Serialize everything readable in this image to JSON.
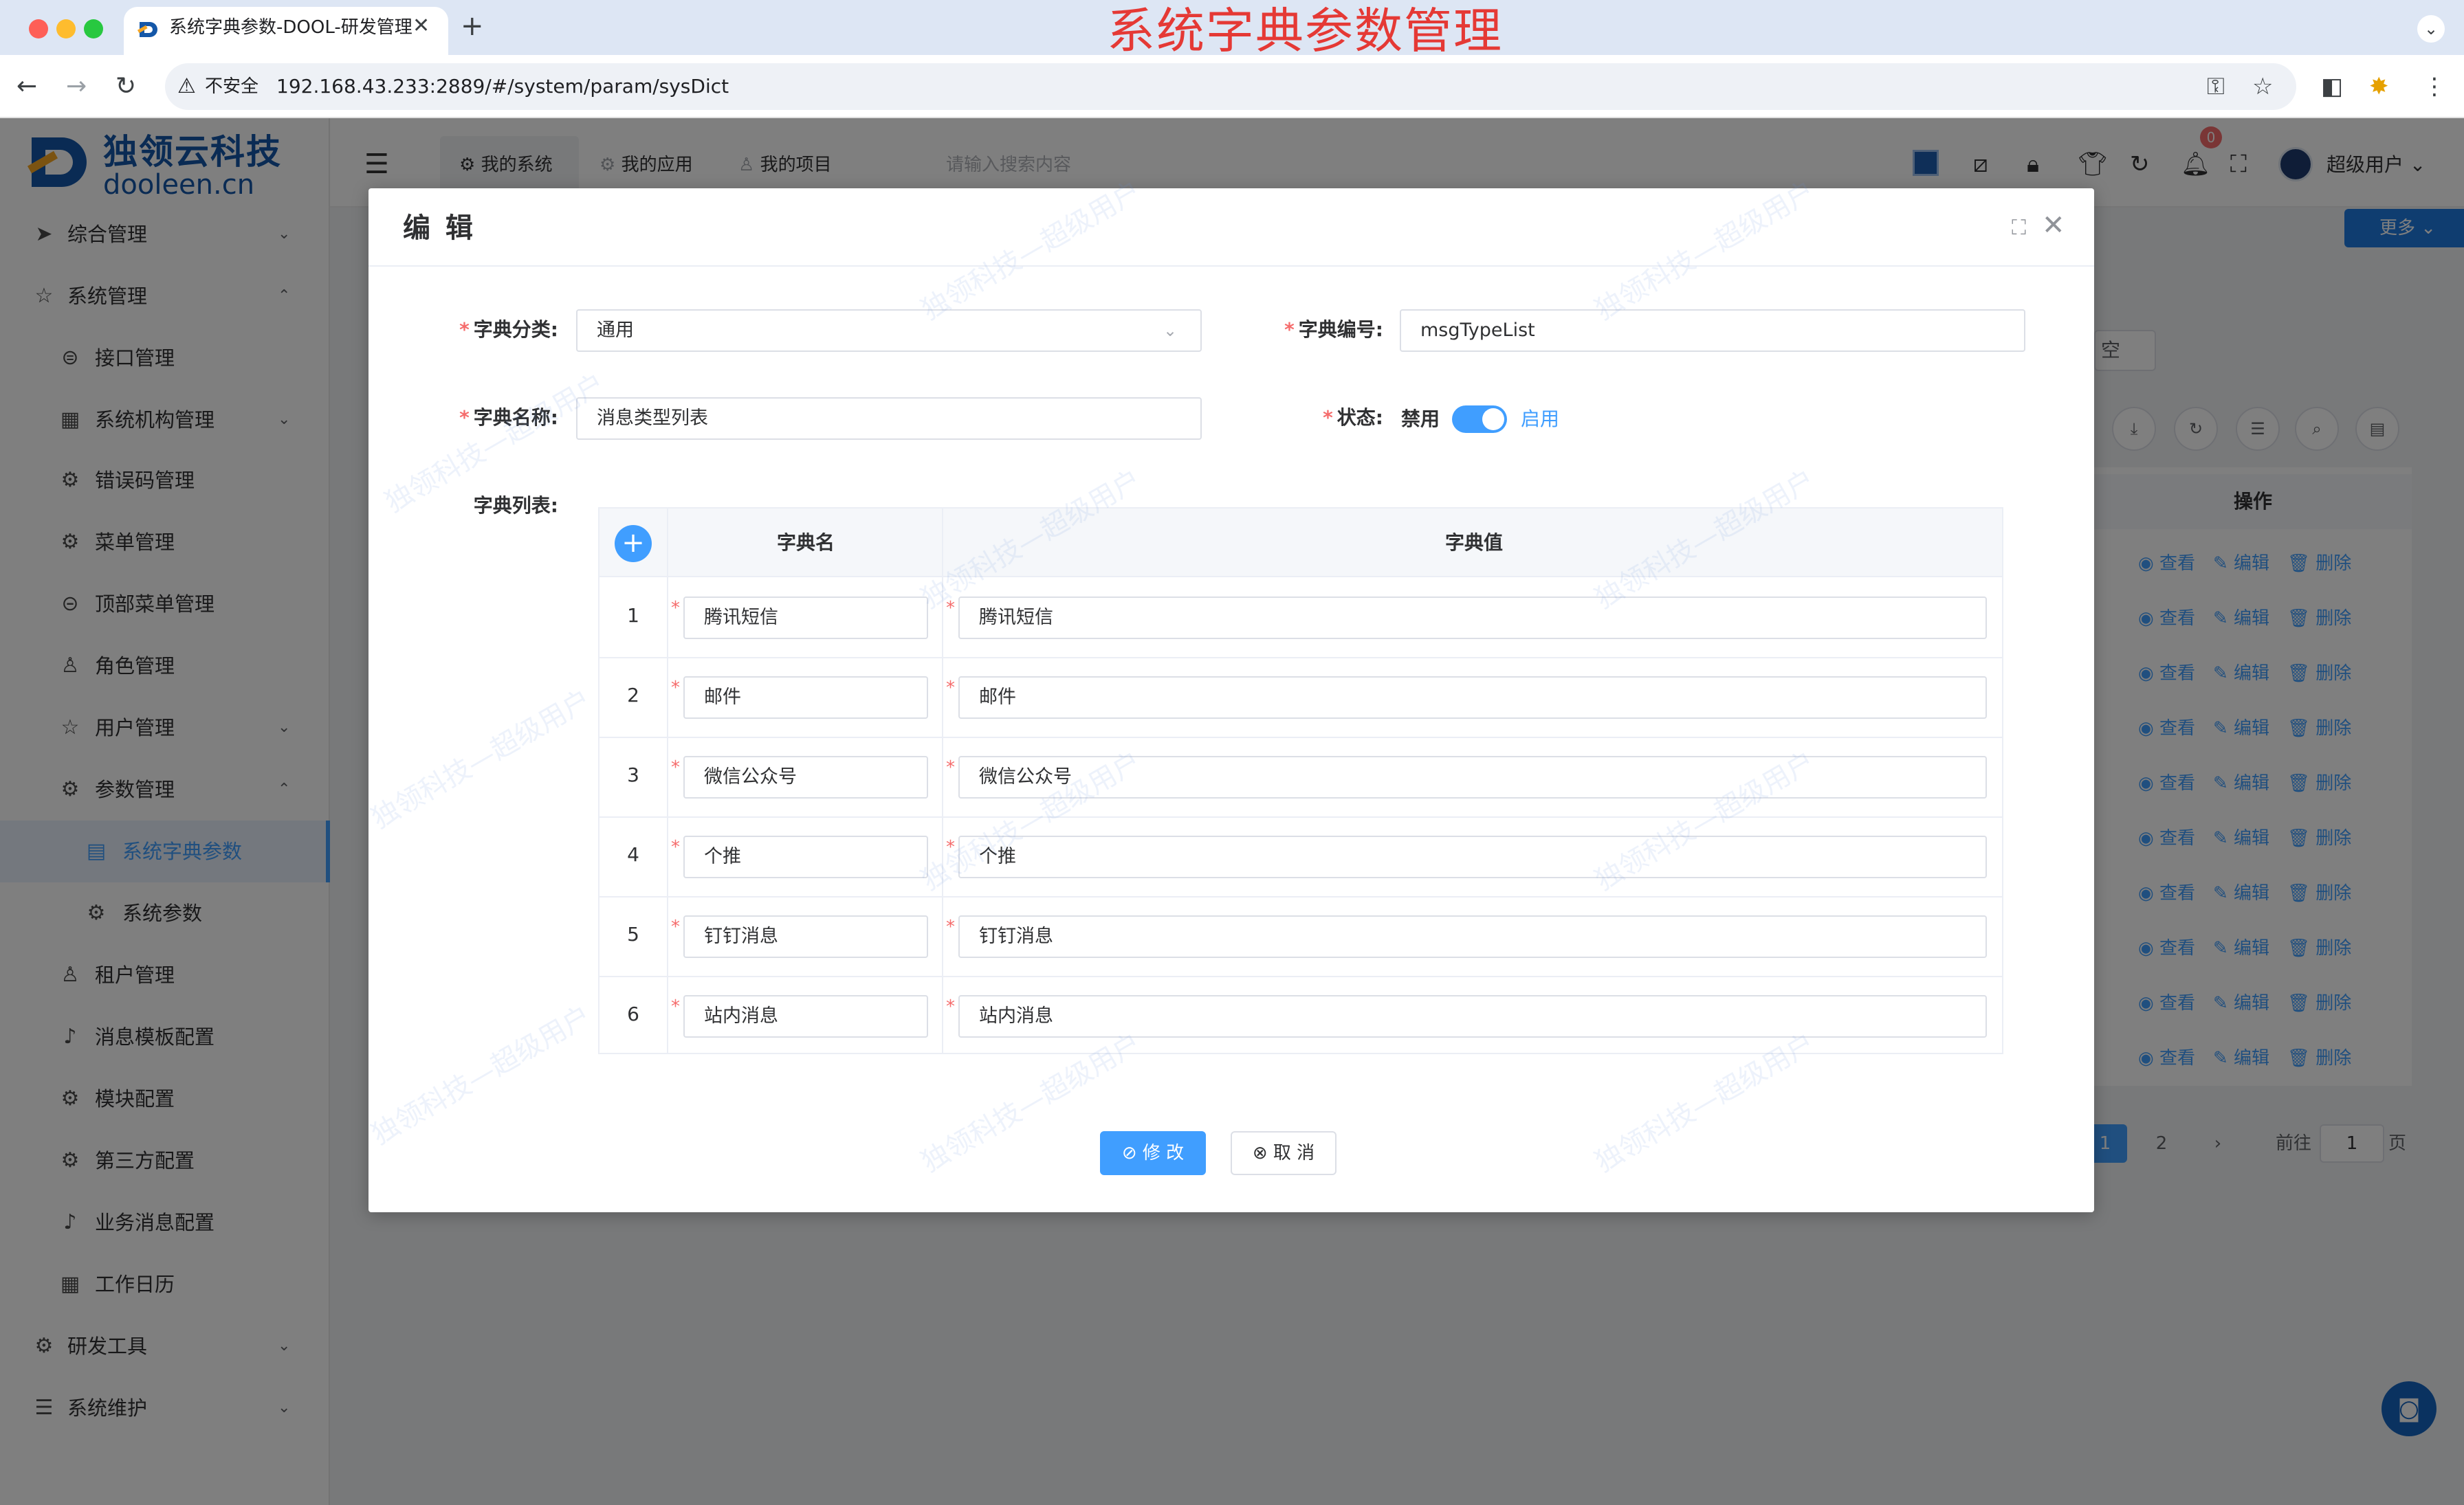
{
  "browser": {
    "tab_title": "系统字典参数-DOOL-研发管理",
    "tab_close": "✕",
    "new_tab": "+",
    "overlay_caption": "系统字典参数管理",
    "security_label": "不安全",
    "url": "192.168.43.233:2889/#/system/param/sysDict",
    "tabs_menu": "⌄"
  },
  "brand": {
    "name_cn": "独领云科技",
    "name_en": "dooleen.cn"
  },
  "sidebar": {
    "items": [
      {
        "label": "综合管理",
        "icon": "send-icon",
        "glyph": "➤",
        "chevron": "⌄"
      },
      {
        "label": "系统管理",
        "icon": "star-icon",
        "glyph": "☆",
        "chevron": "⌃"
      },
      {
        "label": "接口管理",
        "icon": "api-icon",
        "glyph": "⊜"
      },
      {
        "label": "系统机构管理",
        "icon": "grid-icon",
        "glyph": "▦",
        "chevron": "⌄"
      },
      {
        "label": "错误码管理",
        "icon": "gear-icon",
        "glyph": "⚙"
      },
      {
        "label": "菜单管理",
        "icon": "settings-icon",
        "glyph": "⚙"
      },
      {
        "label": "顶部菜单管理",
        "icon": "search-icon",
        "glyph": "⊝"
      },
      {
        "label": "角色管理",
        "icon": "user-icon",
        "glyph": "♙"
      },
      {
        "label": "用户管理",
        "icon": "star-icon",
        "glyph": "☆",
        "chevron": "⌄"
      },
      {
        "label": "参数管理",
        "icon": "settings-icon",
        "glyph": "⚙",
        "chevron": "⌃"
      },
      {
        "label": "系统字典参数",
        "icon": "document-icon",
        "glyph": "▤"
      },
      {
        "label": "系统参数",
        "icon": "settings-icon",
        "glyph": "⚙"
      },
      {
        "label": "租户管理",
        "icon": "user-icon",
        "glyph": "♙"
      },
      {
        "label": "消息模板配置",
        "icon": "bell-icon",
        "glyph": "♪"
      },
      {
        "label": "模块配置",
        "icon": "settings-icon",
        "glyph": "⚙"
      },
      {
        "label": "第三方配置",
        "icon": "settings-icon",
        "glyph": "⚙"
      },
      {
        "label": "业务消息配置",
        "icon": "bell-icon",
        "glyph": "♪"
      },
      {
        "label": "工作日历",
        "icon": "calendar-icon",
        "glyph": "▦"
      },
      {
        "label": "研发工具",
        "icon": "gear-icon",
        "glyph": "⚙",
        "chevron": "⌄"
      },
      {
        "label": "系统维护",
        "icon": "sliders-icon",
        "glyph": "☰",
        "chevron": "⌄"
      }
    ]
  },
  "header": {
    "tabs": [
      {
        "label": "我的系统",
        "glyph": "⚙"
      },
      {
        "label": "我的应用",
        "glyph": "⚙"
      },
      {
        "label": "我的项目",
        "glyph": "♙"
      }
    ],
    "search_placeholder": "请输入搜索内容",
    "notification_count": "0",
    "user_name": "超级用户",
    "user_chevron": "⌄"
  },
  "background_page": {
    "more_button": "更多 ⌄",
    "clear_button_partial": "空",
    "op_header": "操作",
    "row_actions": [
      "查看",
      "编辑",
      "删除"
    ],
    "row_count": 10,
    "pagination": {
      "pages": [
        "1",
        "2"
      ],
      "next": "›",
      "goto_label": "前往",
      "goto_value": "1",
      "page_suffix": "页"
    }
  },
  "dialog": {
    "title": "编 辑",
    "form": {
      "category_label": "字典分类:",
      "category_value": "通用",
      "code_label": "字典编号:",
      "code_value": "msgTypeList",
      "name_label": "字典名称:",
      "name_value": "消息类型列表",
      "status_label": "状态:",
      "status_off": "禁用",
      "status_on": "启用",
      "status_enabled": true,
      "list_label": "字典列表:"
    },
    "table": {
      "col_name": "字典名",
      "col_value": "字典值",
      "rows": [
        {
          "index": "1",
          "name": "腾讯短信",
          "value": "腾讯短信"
        },
        {
          "index": "2",
          "name": "邮件",
          "value": "邮件"
        },
        {
          "index": "3",
          "name": "微信公众号",
          "value": "微信公众号"
        },
        {
          "index": "4",
          "name": "个推",
          "value": "个推"
        },
        {
          "index": "5",
          "name": "钉钉消息",
          "value": "钉钉消息"
        },
        {
          "index": "6",
          "name": "站内消息",
          "value": "站内消息"
        }
      ]
    },
    "buttons": {
      "save": "⊘ 修 改",
      "cancel": "⊗ 取 消"
    }
  },
  "watermark": "独领科技—超级用户"
}
